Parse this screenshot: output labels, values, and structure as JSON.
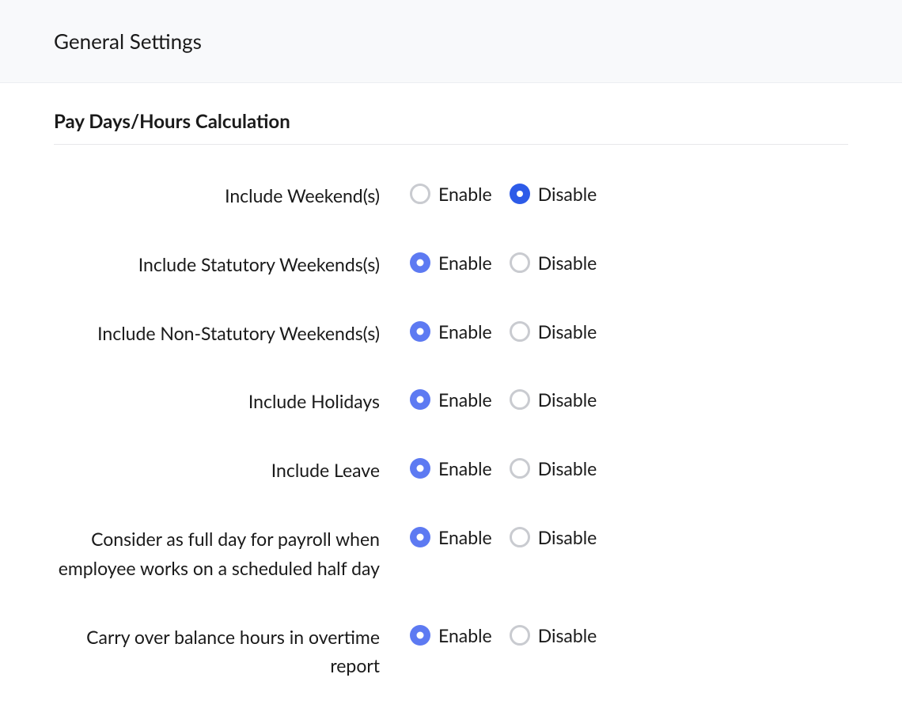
{
  "header": {
    "title": "General Settings"
  },
  "section": {
    "title": "Pay Days/Hours Calculation"
  },
  "labels": {
    "enable": "Enable",
    "disable": "Disable"
  },
  "settings": [
    {
      "id": "include-weekends",
      "label": "Include Weekend(s)",
      "selected": "disable"
    },
    {
      "id": "include-statutory-weekends",
      "label": "Include Statutory Weekends(s)",
      "selected": "enable"
    },
    {
      "id": "include-non-statutory-weekends",
      "label": "Include Non-Statutory Weekends(s)",
      "selected": "enable"
    },
    {
      "id": "include-holidays",
      "label": "Include Holidays",
      "selected": "enable"
    },
    {
      "id": "include-leave",
      "label": "Include Leave",
      "selected": "enable"
    },
    {
      "id": "full-day-half-day",
      "label": "Consider as full day for payroll when employee works on a scheduled half day",
      "selected": "enable"
    },
    {
      "id": "carry-over-overtime",
      "label": "Carry over balance hours in overtime report",
      "selected": "enable"
    }
  ]
}
